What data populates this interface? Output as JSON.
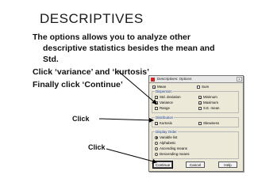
{
  "slide": {
    "title": "DESCRIPTIVES",
    "paragraphs": [
      "The options allows you to analyze other",
      "descriptive statistics besides the mean and",
      "Std.",
      "Click ‘variance’ and ‘kurtosis’",
      "Finally click ‘Continue’"
    ],
    "callouts": [
      "Click",
      "Click"
    ]
  },
  "dialog": {
    "title": "Descriptives: Options",
    "close_glyph": "×",
    "top_options": [
      {
        "label": "Mean",
        "checked": true
      },
      {
        "label": "Sum",
        "checked": false
      }
    ],
    "dispersion": {
      "label": "Dispersion",
      "items": [
        {
          "label": "Std. deviation",
          "checked": true
        },
        {
          "label": "Minimum",
          "checked": true
        },
        {
          "label": "Variance",
          "checked": true
        },
        {
          "label": "Maximum",
          "checked": true
        },
        {
          "label": "Range",
          "checked": false
        },
        {
          "label": "S.E. mean",
          "checked": false
        }
      ]
    },
    "distribution": {
      "label": "Distribution",
      "items": [
        {
          "label": "Kurtosis",
          "checked": true
        },
        {
          "label": "Skewness",
          "checked": false
        }
      ]
    },
    "display_order": {
      "label": "Display Order",
      "items": [
        {
          "label": "Variable list",
          "selected": true
        },
        {
          "label": "Alphabetic",
          "selected": false
        },
        {
          "label": "Ascending means",
          "selected": false
        },
        {
          "label": "Descending means",
          "selected": false
        }
      ]
    },
    "buttons": {
      "continue": "Continue",
      "cancel": "Cancel",
      "help": "Help"
    },
    "check_glyph": "✓"
  },
  "colors": {
    "arrow": "#000000",
    "group_label": "#1b3f9a"
  }
}
